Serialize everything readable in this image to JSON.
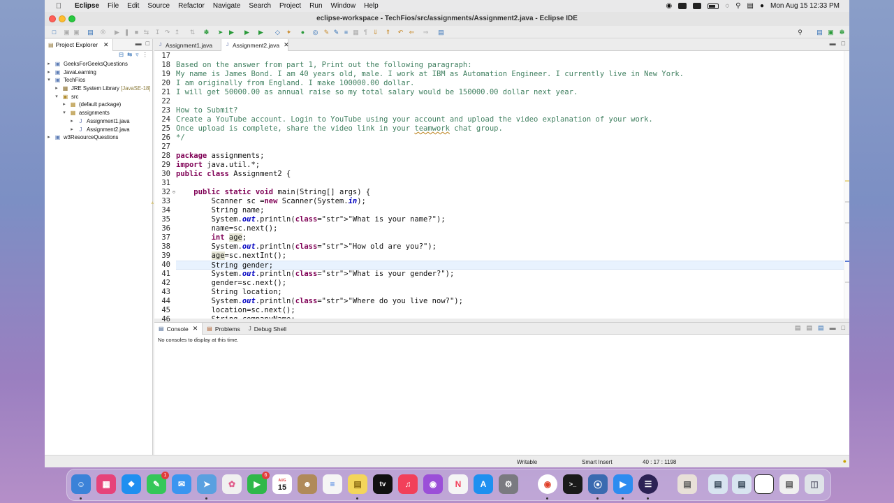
{
  "menubar": {
    "app": "Eclipse",
    "items": [
      "File",
      "Edit",
      "Source",
      "Refactor",
      "Navigate",
      "Search",
      "Project",
      "Run",
      "Window",
      "Help"
    ],
    "datetime": "Mon Aug 15  12:33 PM"
  },
  "window": {
    "title": "eclipse-workspace - TechFios/src/assignments/Assignment2.java - Eclipse IDE"
  },
  "explorer": {
    "title": "Project Explorer",
    "tree": [
      {
        "label": "GeeksForGeeksQuestions",
        "icon": "folder-project-icon",
        "expanded": false
      },
      {
        "label": "JavaLearning",
        "icon": "folder-project-icon",
        "expanded": false
      },
      {
        "label": "TechFios",
        "icon": "folder-project-icon",
        "expanded": true
      },
      {
        "label": "JRE System Library",
        "decoration": "[JavaSE-18]",
        "icon": "library-icon",
        "expanded": false
      },
      {
        "label": "src",
        "icon": "source-folder-icon",
        "expanded": true
      },
      {
        "label": "(default package)",
        "icon": "package-icon",
        "expanded": false
      },
      {
        "label": "assignments",
        "icon": "package-icon",
        "expanded": true
      },
      {
        "label": "Assignment1.java",
        "icon": "java-file-icon",
        "expanded": false
      },
      {
        "label": "Assignment2.java",
        "icon": "java-file-icon",
        "expanded": false
      },
      {
        "label": "w3ResourceQuestions",
        "icon": "folder-project-icon",
        "expanded": false
      }
    ]
  },
  "editor": {
    "tabs": [
      {
        "label": "Assignment1.java",
        "active": false
      },
      {
        "label": "Assignment2.java",
        "active": true
      }
    ],
    "lines": [
      {
        "n": "17",
        "t": ""
      },
      {
        "n": "18",
        "t": "Based on the answer from part 1, Print out the following paragraph:"
      },
      {
        "n": "19",
        "t": "My name is James Bond. I am 40 years old, male. I work at IBM as Automation Engineer. I currently live in New York."
      },
      {
        "n": "20",
        "t": "I am originally from England. I make 100000.00 dollar."
      },
      {
        "n": "21",
        "t": "I will get 50000.00 as annual raise so my total salary would be 150000.00 dollar next year."
      },
      {
        "n": "22",
        "t": ""
      },
      {
        "n": "23",
        "t": "How to Submit?"
      },
      {
        "n": "24",
        "t": "Create a YouTube account. Login to YouTube using your account and upload the video explanation of your work."
      },
      {
        "n": "25",
        "t": "Once upload is complete, share the video link in your teamwork chat group."
      },
      {
        "n": "26",
        "t": "*/"
      },
      {
        "n": "27",
        "t": ""
      },
      {
        "n": "28",
        "t": "package assignments;"
      },
      {
        "n": "29",
        "t": "import java.util.*;"
      },
      {
        "n": "30",
        "t": "public class Assignment2 {"
      },
      {
        "n": "31",
        "t": ""
      },
      {
        "n": "32",
        "t": "    public static void main(String[] args) {"
      },
      {
        "n": "33",
        "t": "        Scanner sc =new Scanner(System.in);"
      },
      {
        "n": "34",
        "t": "        String name;"
      },
      {
        "n": "35",
        "t": "        System.out.println(\"What is your name?\");"
      },
      {
        "n": "36",
        "t": "        name=sc.next();"
      },
      {
        "n": "37",
        "t": "        int age;"
      },
      {
        "n": "38",
        "t": "        System.out.println(\"How old are you?\");"
      },
      {
        "n": "39",
        "t": "        age=sc.nextInt();"
      },
      {
        "n": "40",
        "t": "        String gender;"
      },
      {
        "n": "41",
        "t": "        System.out.println(\"What is your gender?\");"
      },
      {
        "n": "42",
        "t": "        gender=sc.next();"
      },
      {
        "n": "43",
        "t": "        String location;"
      },
      {
        "n": "44",
        "t": "        System.out.println(\"Where do you live now?\");"
      },
      {
        "n": "45",
        "t": "        location=sc.next();"
      },
      {
        "n": "46",
        "t": "        String companyName;"
      }
    ]
  },
  "console": {
    "tabs": [
      {
        "label": "Console",
        "icon": "console-icon",
        "active": true
      },
      {
        "label": "Problems",
        "icon": "problems-icon",
        "active": false
      },
      {
        "label": "Debug Shell",
        "icon": "debug-shell-icon",
        "active": false
      }
    ],
    "message": "No consoles to display at this time."
  },
  "status": {
    "writable": "Writable",
    "insert_mode": "Smart Insert",
    "position": "40 : 17 : 1198"
  },
  "dock": {
    "calendar_month": "AUG",
    "calendar_day": "15",
    "messages_badge": "1",
    "facetime_badge": "6",
    "tv_label": "tv"
  }
}
